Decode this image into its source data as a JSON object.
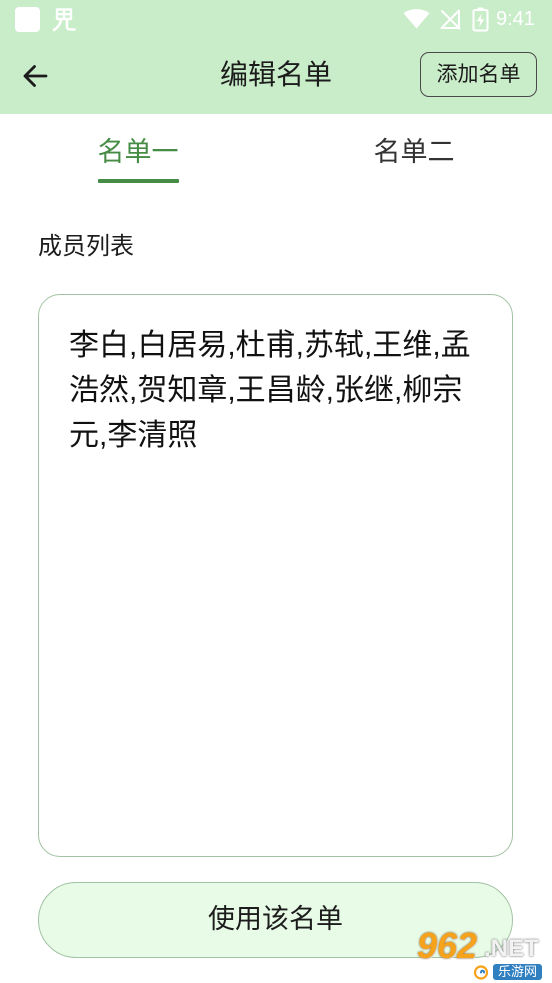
{
  "status_bar": {
    "time": "9:41",
    "left_icons": [
      "app-square-icon",
      "app-notification-icon"
    ],
    "right_icons": [
      "wifi-icon",
      "no-signal-icon",
      "battery-charging-icon"
    ]
  },
  "header": {
    "back_icon": "back-arrow-icon",
    "title": "编辑名单",
    "add_button_label": "添加名单"
  },
  "tabs": [
    {
      "label": "名单一",
      "active": true
    },
    {
      "label": "名单二",
      "active": false
    }
  ],
  "members": {
    "label": "成员列表",
    "value": "李白,白居易,杜甫,苏轼,王维,孟浩然,贺知章,王昌龄,张继,柳宗元,李清照"
  },
  "actions": {
    "use_button_label": "使用该名单"
  },
  "watermark": {
    "number": "962",
    "suffix": ".NET",
    "name": "乐游网"
  },
  "colors": {
    "bar_background": "#c9ecc9",
    "accent": "#468c46",
    "field_border": "#a3c2a3",
    "button_background": "#e7fbe6",
    "status_icons": "#ffffff",
    "text": "#1c1c1c",
    "inactive_tab": "#333333"
  }
}
